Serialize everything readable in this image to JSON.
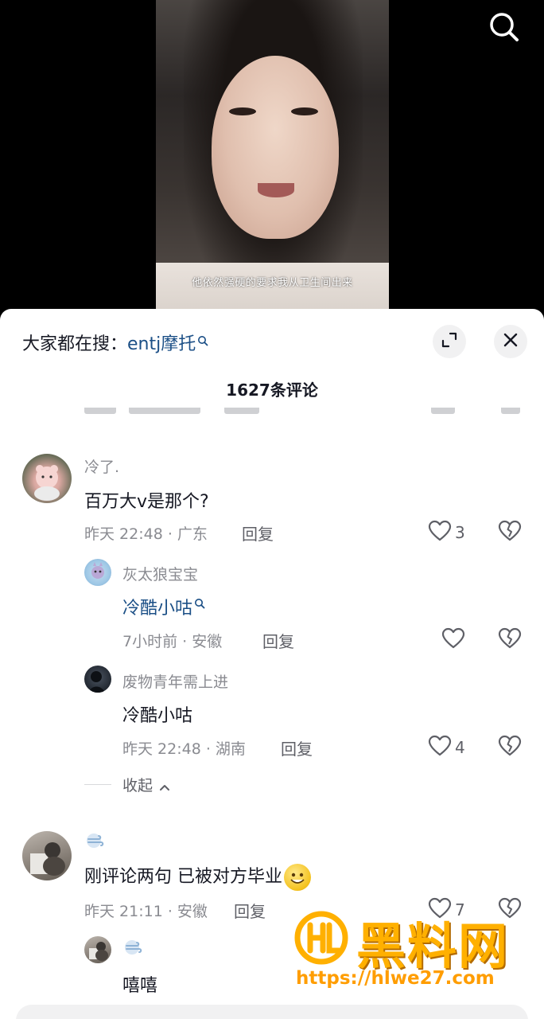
{
  "video": {
    "subtitle": "他依然强硬的要求我从卫生间出来"
  },
  "panel": {
    "search_prefix": "大家都在搜：",
    "search_keyword": "entj摩托",
    "comment_count_title": "1627条评论"
  },
  "comments": [
    {
      "user": "冷了.",
      "text": "百万大v是那个?",
      "meta": "昨天 22:48 · 广东",
      "reply_label": "回复",
      "likes": "3",
      "replies": [
        {
          "user": "灰太狼宝宝",
          "text": "冷酷小咕",
          "meta": "7小时前 · 安徽",
          "reply_label": "回复",
          "likes": ""
        },
        {
          "user": "废物青年需上进",
          "text": "冷酷小咕",
          "meta": "昨天 22:48 · 湖南",
          "reply_label": "回复",
          "likes": "4"
        }
      ],
      "collapse_label": "收起"
    },
    {
      "user": "",
      "text": "刚评论两句  已被对方毕业",
      "meta": "昨天 21:11 · 安徽",
      "reply_label": "回复",
      "likes": "7",
      "replies": [
        {
          "user": "",
          "text": "嘻嘻"
        }
      ]
    }
  ],
  "watermark": {
    "brand": "黑料网",
    "url": "https://hlwe27.com"
  },
  "colors": {
    "link": "#1b4f86",
    "meta_text": "#8a8b91",
    "watermark": "#ffb000"
  }
}
